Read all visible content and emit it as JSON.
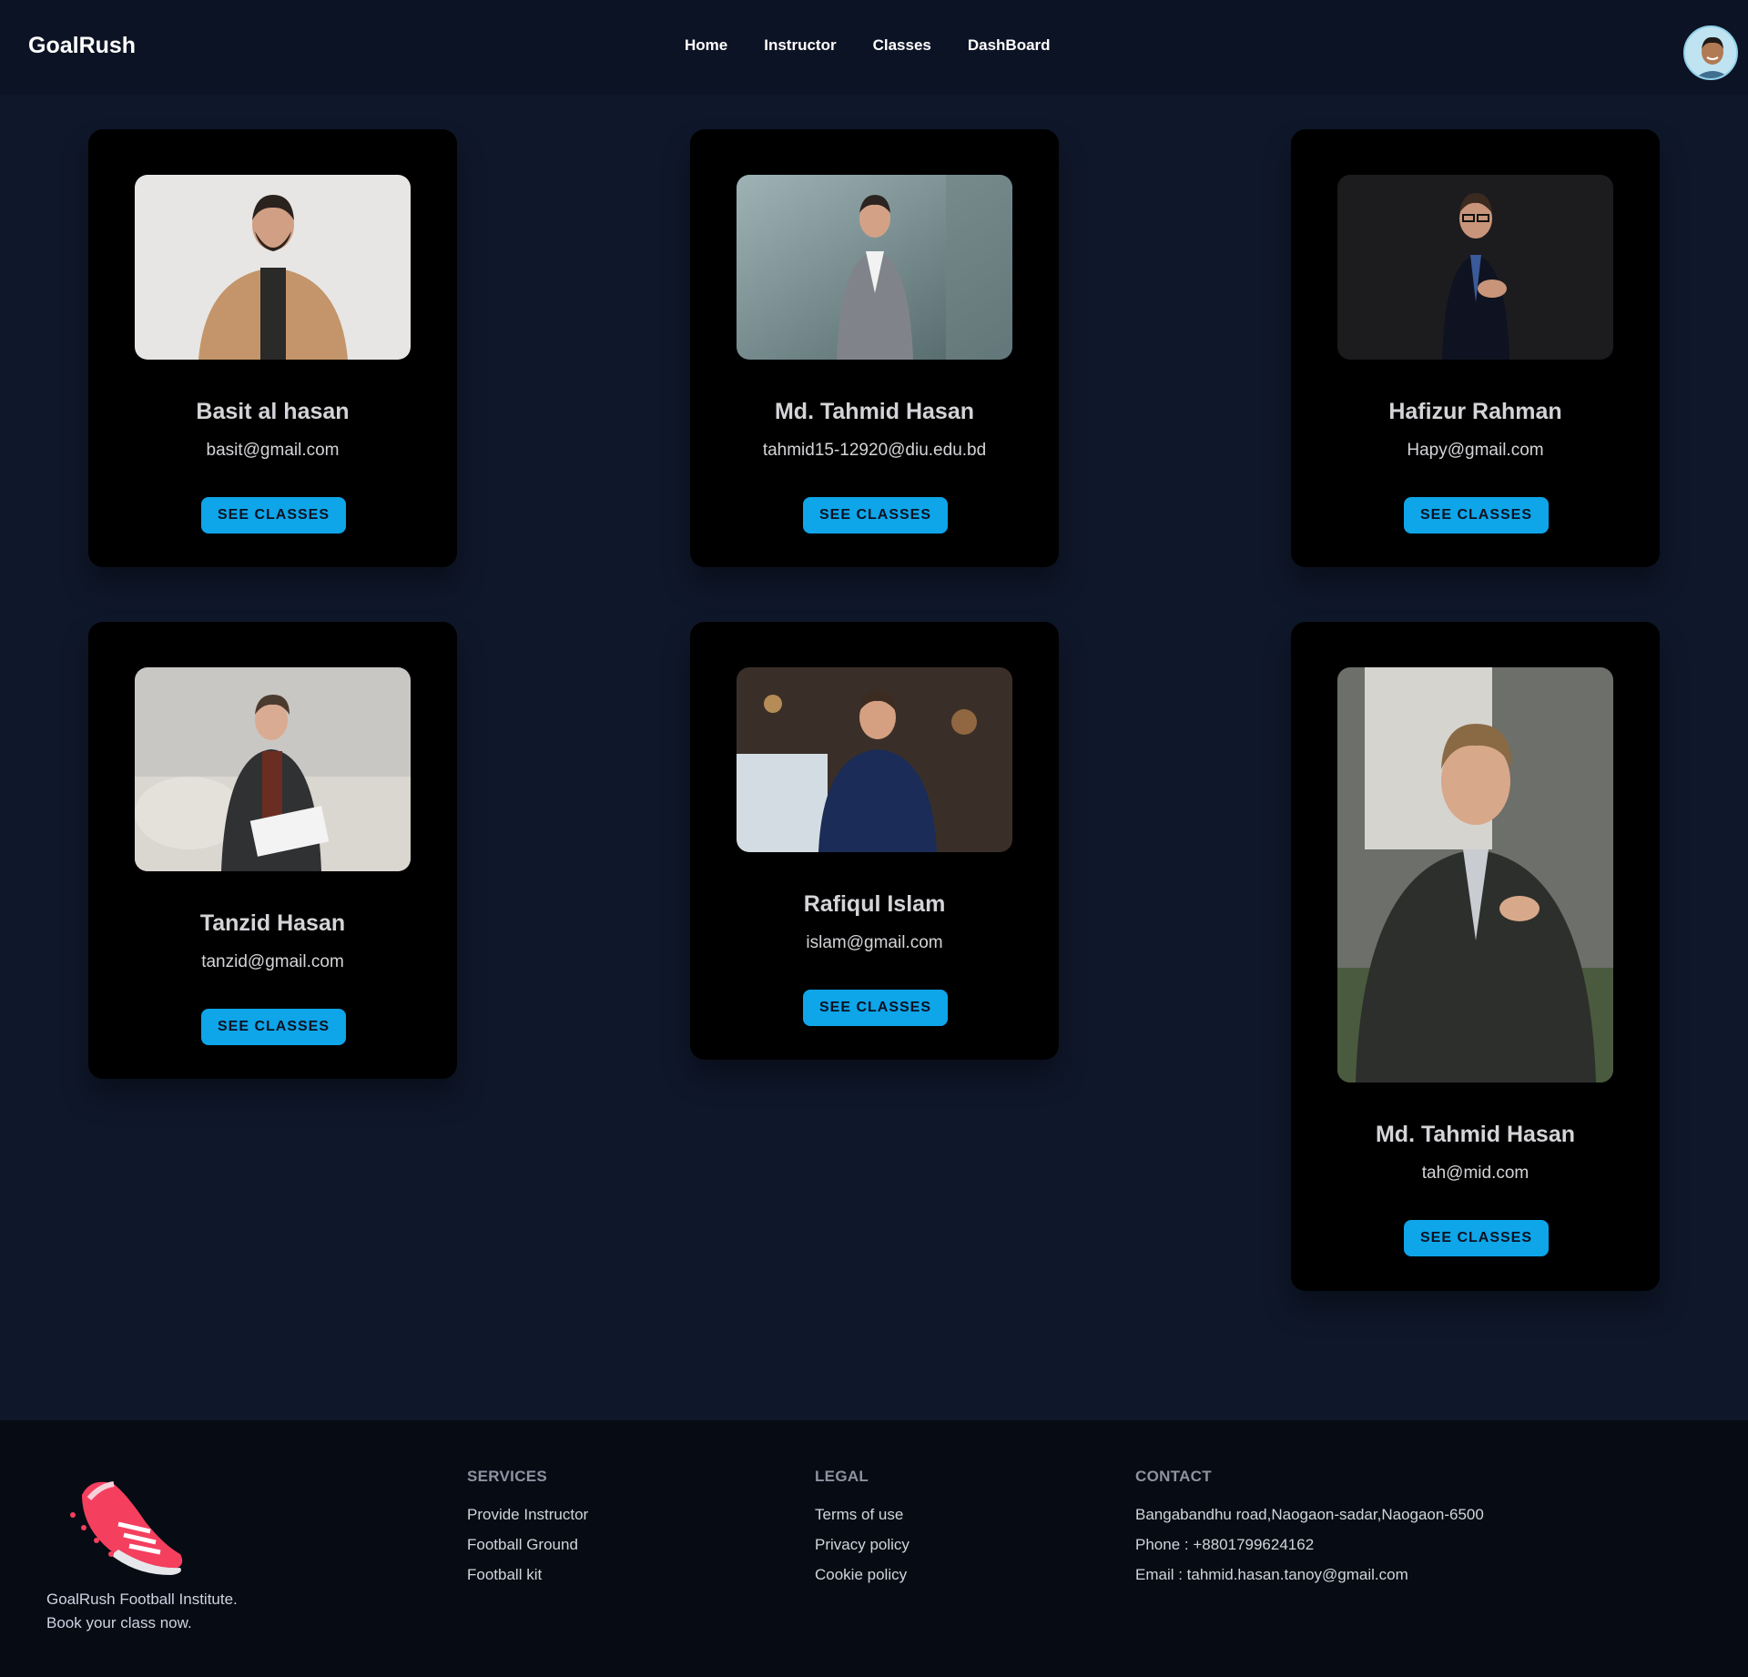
{
  "navbar": {
    "brand": "GoalRush",
    "links": [
      "Home",
      "Instructor",
      "Classes",
      "DashBoard"
    ]
  },
  "instructors": [
    {
      "name": "Basit al hasan",
      "email": "basit@gmail.com",
      "button": "SEE CLASSES"
    },
    {
      "name": "Md. Tahmid Hasan",
      "email": "tahmid15-12920@diu.edu.bd",
      "button": "SEE CLASSES"
    },
    {
      "name": "Hafizur Rahman",
      "email": "Hapy@gmail.com",
      "button": "SEE CLASSES"
    },
    {
      "name": "Tanzid Hasan",
      "email": "tanzid@gmail.com",
      "button": "SEE CLASSES"
    },
    {
      "name": "Rafiqul Islam",
      "email": "islam@gmail.com",
      "button": "SEE CLASSES"
    },
    {
      "name": "Md. Tahmid Hasan",
      "email": "tah@mid.com",
      "button": "SEE CLASSES"
    }
  ],
  "footer": {
    "about_line1": "GoalRush Football Institute.",
    "about_line2": "Book your class now.",
    "services": {
      "title": "SERVICES",
      "links": [
        "Provide Instructor",
        "Football Ground",
        "Football kit"
      ]
    },
    "legal": {
      "title": "LEGAL",
      "links": [
        "Terms of use",
        "Privacy policy",
        "Cookie policy"
      ]
    },
    "contact": {
      "title": "CONTACT",
      "address": "Bangabandhu road,Naogaon-sadar,Naogaon-6500",
      "phone": "Phone : +8801799624162",
      "email": "Email : tahmid.hasan.tanoy@gmail.com"
    }
  },
  "colors": {
    "page_bg": "#0f172a",
    "nav_bg": "#0c1324",
    "card_bg": "#000000",
    "button": "#0ea5e9",
    "footer_bg": "#070b14",
    "logo_accent": "#f43f5e"
  },
  "icons": {
    "profile": "user-avatar",
    "footer_logo": "football-boot-icon"
  }
}
